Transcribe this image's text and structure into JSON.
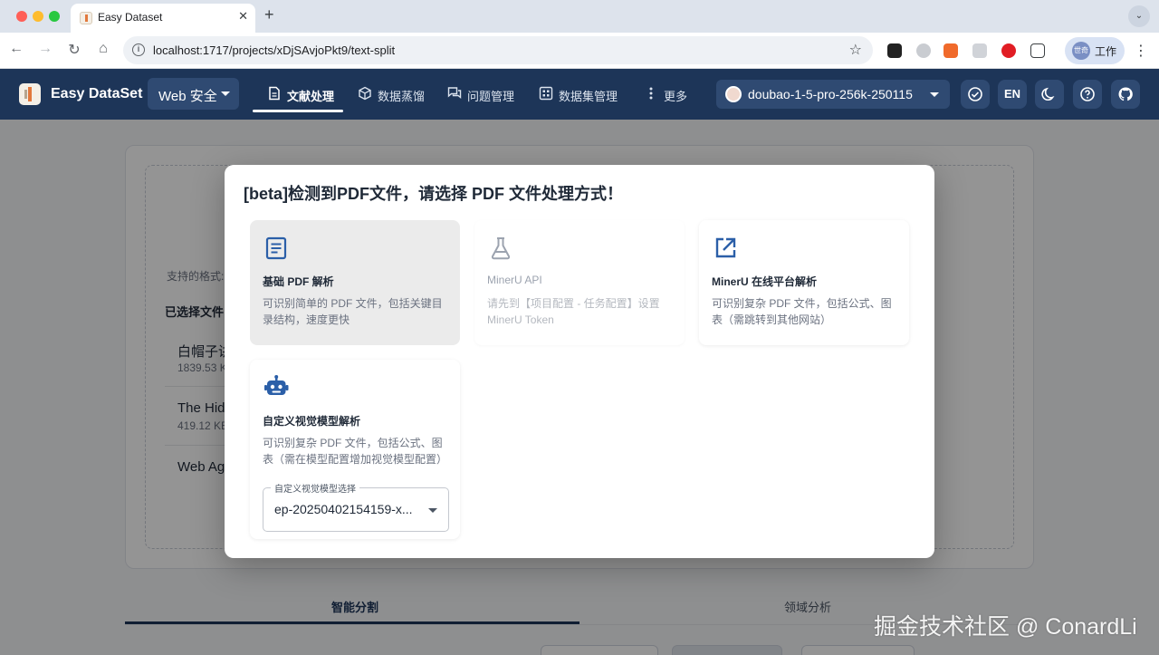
{
  "browser": {
    "tab_title": "Easy Dataset",
    "url": "localhost:1717/projects/xDjSAvjoPkt9/text-split",
    "profile_label": "工作",
    "profile_avatar_text": "世奇"
  },
  "app": {
    "title": "Easy DataSet",
    "project": "Web 安全",
    "nav": [
      {
        "label": "文献处理",
        "icon": "document-icon",
        "active": true
      },
      {
        "label": "数据蒸馏",
        "icon": "cube-icon"
      },
      {
        "label": "问题管理",
        "icon": "chat-icon"
      },
      {
        "label": "数据集管理",
        "icon": "grid-icon"
      },
      {
        "label": "更多",
        "icon": "more-vertical-icon"
      }
    ],
    "model": "doubao-1-5-pro-256k-250115",
    "lang_button": "EN"
  },
  "background": {
    "formats_label": "支持的格式:",
    "selected_files_label": "已选择文件",
    "files": [
      {
        "name": "白帽子讲",
        "size": "1839.53 K"
      },
      {
        "name": "The Hid",
        "size": "419.12 KE"
      },
      {
        "name": "Web Ag",
        "size": ""
      }
    ],
    "tabs": [
      "智能分割",
      "领域分析"
    ]
  },
  "dialog": {
    "title": "[beta]检测到PDF文件，请选择 PDF 文件处理方式！",
    "options": [
      {
        "title": "基础 PDF 解析",
        "desc": "可识别简单的 PDF 文件，包括关键目录结构，速度更快",
        "icon": "document-lines-icon",
        "state": "selected"
      },
      {
        "title": "MinerU API",
        "desc": "请先到【项目配置 - 任务配置】设置 MinerU Token",
        "icon": "flask-icon",
        "state": "disabled"
      },
      {
        "title": "MinerU 在线平台解析",
        "desc": "可识别复杂 PDF 文件，包括公式、图表（需跳转到其他网站）",
        "icon": "external-link-icon",
        "state": "normal"
      },
      {
        "title": "自定义视觉模型解析",
        "desc": "可识别复杂 PDF 文件，包括公式、图表（需在模型配置增加视觉模型配置）",
        "icon": "robot-icon",
        "state": "normal"
      }
    ],
    "vision_model_label": "自定义视觉模型选择",
    "vision_model_value": "ep-20250402154159-x..."
  },
  "watermark": "掘金技术社区 @ ConardLi",
  "colors": {
    "header_bg": "#1d3558",
    "accent": "#1d3558",
    "icon_blue": "#2b5fa8"
  }
}
